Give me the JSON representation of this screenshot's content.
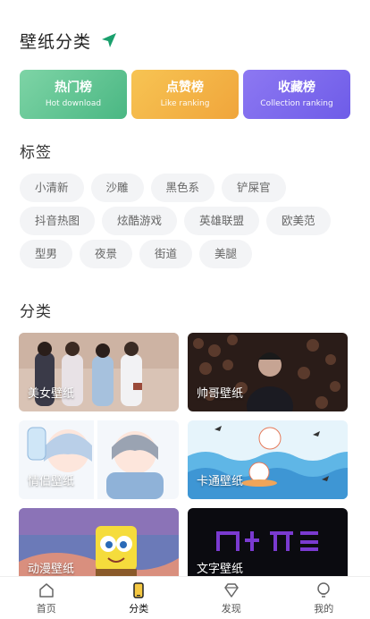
{
  "header": {
    "title": "壁纸分类",
    "icon": "send-icon",
    "icon_color": "#1aa06d"
  },
  "rankings": [
    {
      "title": "热门榜",
      "subtitle": "Hot download"
    },
    {
      "title": "点赞榜",
      "subtitle": "Like ranking"
    },
    {
      "title": "收藏榜",
      "subtitle": "Collection ranking"
    }
  ],
  "tags_section": {
    "title": "标签",
    "rows": [
      [
        "小清新",
        "沙雕",
        "黑色系",
        "铲屎官"
      ],
      [
        "抖音热图",
        "炫酷游戏",
        "英雄联盟",
        "欧美范"
      ],
      [
        "型男",
        "夜景",
        "街道",
        "美腿"
      ]
    ]
  },
  "category_section": {
    "title": "分类",
    "items": [
      {
        "label": "美女壁纸"
      },
      {
        "label": "帅哥壁纸"
      },
      {
        "label": "情侣壁纸"
      },
      {
        "label": "卡通壁纸"
      },
      {
        "label": "动漫壁纸"
      },
      {
        "label": "文字壁纸"
      }
    ]
  },
  "tabbar": {
    "items": [
      {
        "label": "首页",
        "icon": "home-icon"
      },
      {
        "label": "分类",
        "icon": "category-icon",
        "active": true
      },
      {
        "label": "发现",
        "icon": "diamond-icon"
      },
      {
        "label": "我的",
        "icon": "lightbulb-icon"
      }
    ]
  }
}
